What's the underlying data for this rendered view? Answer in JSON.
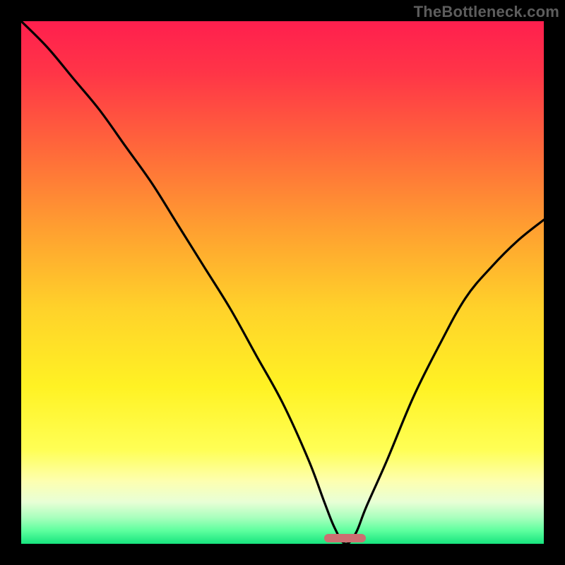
{
  "attribution": "TheBottleneck.com",
  "colors": {
    "frame": "#000000",
    "gradient_stops": [
      {
        "offset": 0.0,
        "color": "#ff1f4e"
      },
      {
        "offset": 0.1,
        "color": "#ff3547"
      },
      {
        "offset": 0.25,
        "color": "#ff6a3a"
      },
      {
        "offset": 0.4,
        "color": "#ffa030"
      },
      {
        "offset": 0.55,
        "color": "#ffd22a"
      },
      {
        "offset": 0.7,
        "color": "#fff224"
      },
      {
        "offset": 0.82,
        "color": "#ffff55"
      },
      {
        "offset": 0.88,
        "color": "#fdffb0"
      },
      {
        "offset": 0.92,
        "color": "#e8ffd6"
      },
      {
        "offset": 0.95,
        "color": "#a8ffbd"
      },
      {
        "offset": 0.975,
        "color": "#5dff9e"
      },
      {
        "offset": 1.0,
        "color": "#17e47e"
      }
    ],
    "curve": "#000000",
    "marker": "#cc6f71",
    "attribution_text": "#5d5d5d"
  },
  "chart_data": {
    "type": "line",
    "title": "",
    "xlabel": "",
    "ylabel": "",
    "xlim": [
      0,
      100
    ],
    "ylim": [
      0,
      100
    ],
    "optimal_x": 62,
    "optimal_band": [
      58,
      66
    ],
    "series": [
      {
        "name": "bottleneck-curve",
        "x": [
          0,
          5,
          10,
          15,
          20,
          25,
          30,
          35,
          40,
          45,
          50,
          55,
          58,
          60,
          62,
          64,
          66,
          70,
          75,
          80,
          85,
          90,
          95,
          100
        ],
        "y": [
          100,
          95,
          89,
          83,
          76,
          69,
          61,
          53,
          45,
          36,
          27,
          16,
          8,
          3,
          0,
          2,
          7,
          16,
          28,
          38,
          47,
          53,
          58,
          62
        ]
      }
    ]
  }
}
